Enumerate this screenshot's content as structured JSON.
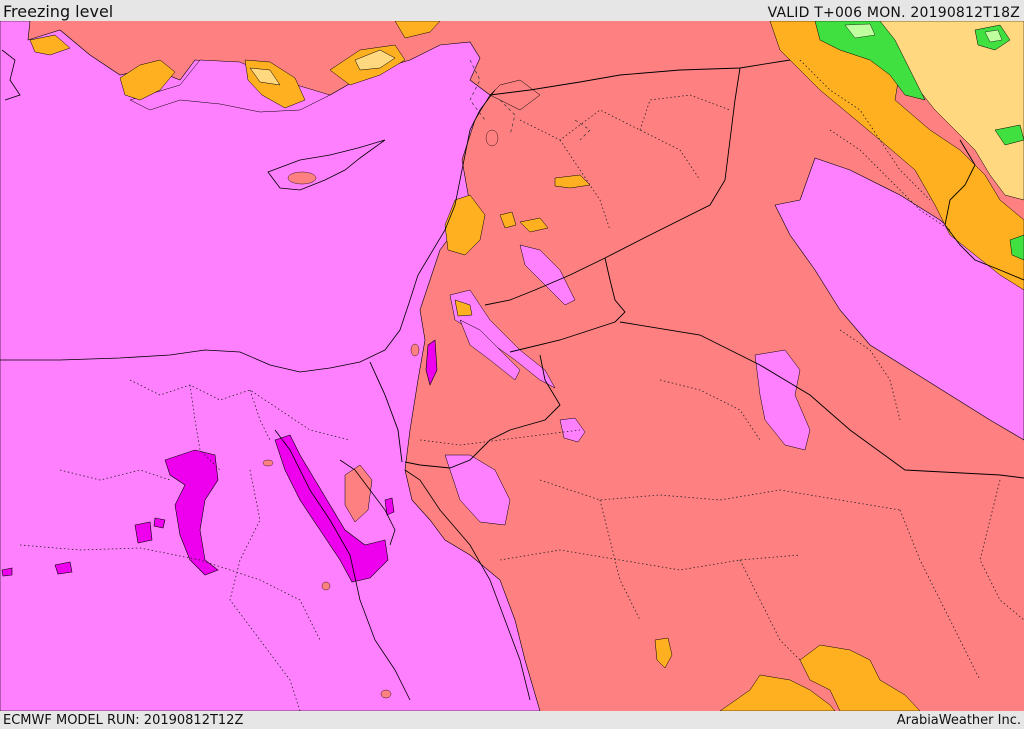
{
  "header": {
    "title": "Freezing level",
    "valid": "VALID T+006 MON. 20190812T18Z"
  },
  "footer": {
    "model_run": "ECMWF MODEL RUN: 20190812T12Z",
    "credit": "ArabiaWeather Inc."
  },
  "map": {
    "colors": {
      "level_1": "#ff80ff",
      "level_2": "#ff8080",
      "level_3": "#ffb020",
      "level_4": "#ffd880",
      "level_5": "#ee00ee",
      "level_6": "#40e040",
      "level_7": "#c0ffa0"
    }
  }
}
